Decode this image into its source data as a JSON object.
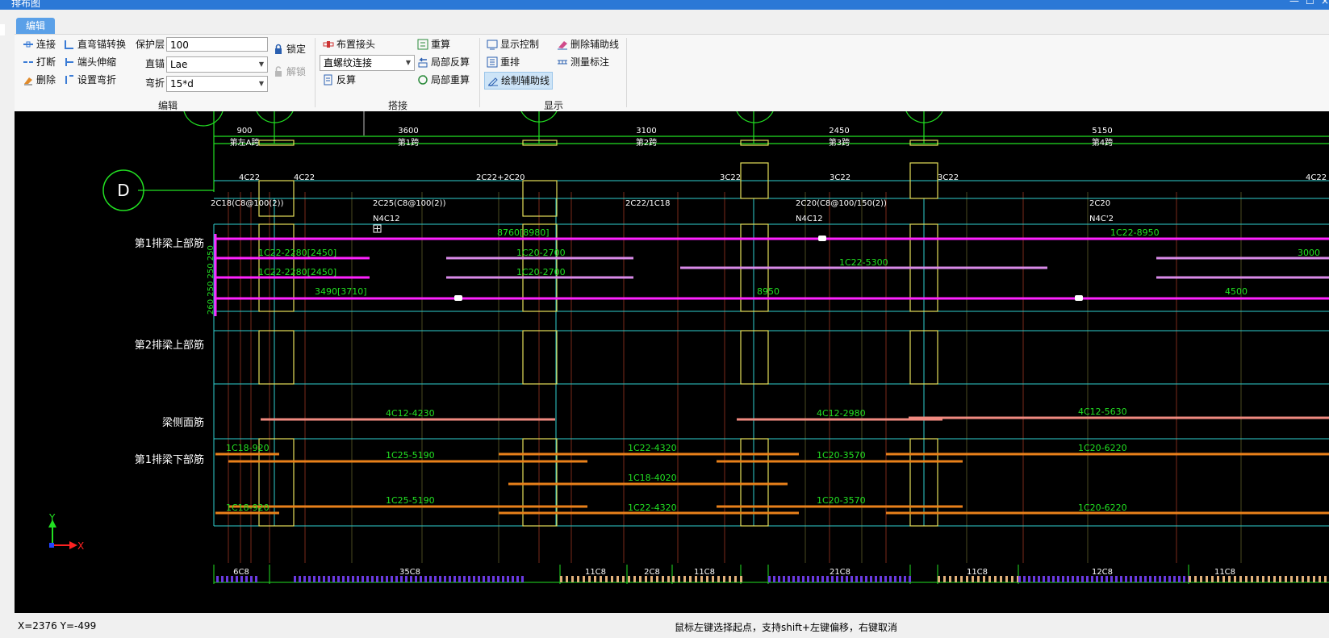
{
  "window": {
    "title": "排布图",
    "min": "—",
    "max": "☐",
    "close": "×"
  },
  "tabs": [
    {
      "label": "编辑"
    }
  ],
  "ribbon": {
    "edit": {
      "connect": "连接",
      "straight_anchor_convert": "直弯锚转换",
      "break": "打断",
      "end_extend": "端头伸缩",
      "delete": "删除",
      "set_bend": "设置弯折",
      "cover_label": "保护层",
      "cover_value": "100",
      "straight_anchor_label": "直锚",
      "straight_anchor_value": "Lae",
      "bend_label": "弯折",
      "bend_value": "15*d",
      "lock": "锁定",
      "unlock": "解锁",
      "group_label": "编辑"
    },
    "splice": {
      "place_joint": "布置接头",
      "joint_type": "直螺纹连接",
      "reverse_calc": "反算",
      "recalc": "重算",
      "local_reverse": "局部反算",
      "local_recalc": "局部重算",
      "group_label": "搭接"
    },
    "display": {
      "display_control": "显示控制",
      "delete_aux": "删除辅助线",
      "rearrange": "重排",
      "measure": "测量标注",
      "draw_aux": "绘制辅助线",
      "group_label": "显示"
    }
  },
  "drawing": {
    "axis_marker": "D",
    "span_dims": [
      "900",
      "3600",
      "3100",
      "2450",
      "5150"
    ],
    "span_names": [
      "第左A跨",
      "第1跨",
      "第2跨",
      "第3跨",
      "第4跨"
    ],
    "top_rebar_labels": [
      "4C22",
      "4C22",
      "2C22+2C20",
      "3C22",
      "3C22",
      "3C22",
      "4C22"
    ],
    "stirrup_labels": [
      "2C18(C8@100(2))",
      "2C25(C8@100(2))",
      "2C22/1C18",
      "2C20(C8@100/150(2))",
      "2C20"
    ],
    "side_labels": [
      "N4C12",
      "N4C12",
      "N4C'2"
    ],
    "row_labels": [
      "第1排梁上部筋",
      "第2排梁上部筋",
      "梁侧面筋",
      "第1排梁下部筋"
    ],
    "vert_dim": "260 250 250 250",
    "top_bars": [
      "8760[8980]",
      "1C22-8950",
      "1C22-2280[2450]",
      "1C20-2700",
      "1C22-2280[2450]",
      "1C20-2700",
      "1C22-5300",
      "3000",
      "3490[3710]",
      "8950",
      "4500"
    ],
    "side_bars": [
      "4C12-4230",
      "4C12-2980",
      "4C12-5630"
    ],
    "bottom_bars": [
      "1C18-920",
      "1C25-5190",
      "1C22-4320",
      "1C20-3570",
      "1C20-6220",
      "1C18-4020",
      "1C18-920",
      "1C25-5190",
      "1C22-4320",
      "1C20-3570",
      "1C20-6220"
    ],
    "stirrup_counts": [
      "6C8",
      "35C8",
      "11C8",
      "2C8",
      "11C8",
      "21C8",
      "11C8",
      "12C8",
      "11C8"
    ],
    "axis_y": "Y",
    "axis_x": "X"
  },
  "status": {
    "coords": "X=2376 Y=-499",
    "hint": "鼠标左键选择起点，支持shift+左键偏移，右键取消"
  },
  "colors": {
    "cad_bg": "#000000",
    "cyan": "#2fd0d0",
    "yellow": "#e6e05a",
    "green": "#22e022",
    "magenta": "#ff22ff",
    "violet": "#d98ae8",
    "orange": "#e8801a",
    "salmon": "#f08a80",
    "blue_stirrup": "#6a3ae0",
    "tan_stirrup": "#e0b07a"
  }
}
